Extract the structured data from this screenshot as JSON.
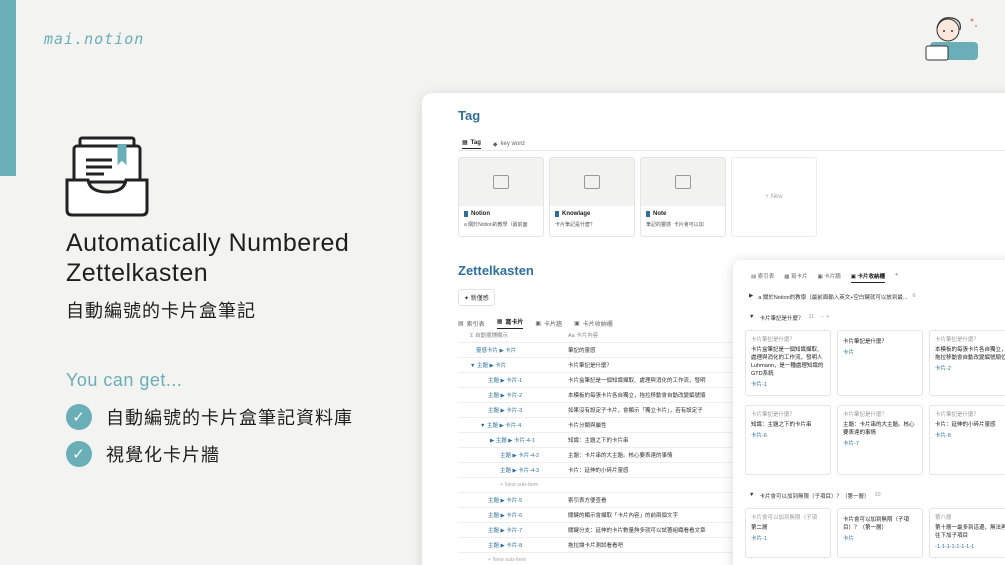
{
  "brand": "mai.notion",
  "hero": {
    "title_line1": "Automatically Numbered",
    "title_line2": "Zettelkasten",
    "title_zh": "自動編號的卡片盒筆記",
    "you_can_get": "You can get...",
    "features": [
      "自動編號的卡片盒筆記資料庫",
      "視覺化卡片牆"
    ]
  },
  "colors": {
    "accent": "#6aaeb8",
    "link": "#2f6f9e"
  },
  "tag_section": {
    "title": "Tag",
    "tabs": [
      "Tag",
      "key word"
    ],
    "cards": [
      {
        "name": "Notion",
        "sub": "a 關於Notion的教學（最前面"
      },
      {
        "name": "Knowlage",
        "sub": "卡片筆記是什麼？"
      },
      {
        "name": "Note",
        "sub": "筆記的靈感"
      }
    ],
    "second_sub": "卡片會可以加",
    "new_label": "+ New"
  },
  "zettel": {
    "title": "Zettelkasten",
    "new_button": "新僅感",
    "tabs": [
      "索引表",
      "寫卡片",
      "卡片牆",
      "卡片收納櫃"
    ],
    "columns": [
      "自動擺鋪顯示",
      "Aa 卡片內容"
    ],
    "rows": [
      {
        "a": "靈感卡片 ▶ 卡片",
        "b": "筆記的靈感"
      },
      {
        "a": "▼ 主題 ▶ 卡片",
        "b": "卡片筆記是什麼？"
      },
      {
        "a": "主題 ▶ 卡片-1",
        "b": "卡片盒筆記是一個知識擷取、處理與消化的工作流，發明"
      },
      {
        "a": "主題 ▶ 卡片-2",
        "b": "本模板的每張卡片各自獨立，拖拉移動會自動改變編號順"
      },
      {
        "a": "主題 ▶ 卡片-3",
        "b": "如果沒有設定子卡片，會顯示「獨立卡片」，若有設定子"
      },
      {
        "a": "▼ 主題 ▶ 卡片-4",
        "b": "卡片分類與屬性"
      },
      {
        "a": "▶ 主題 ▶ 卡片-4-1",
        "b": "知識：主題之下的卡片串"
      },
      {
        "a": "主題 ▶ 卡片-4-2",
        "b": "主題：卡片串的大主題。核心要表達的事情"
      },
      {
        "a": "主題 ▶ 卡片-4-3",
        "b": "卡片：延伸的小碎片靈感"
      },
      {
        "a": "+ New sub-item",
        "b": ""
      },
      {
        "a": "主題 ▶ 卡片-5",
        "b": "索引表方便查看"
      },
      {
        "a": "主題 ▶ 卡片-6",
        "b": "關鍵的顯示會擷取「卡片內容」的前兩個文字"
      },
      {
        "a": "主題 ▶ 卡片-7",
        "b": "關鍵分支：延伸的卡片數量夠多就可以試著組織看看文章"
      },
      {
        "a": "主題 ▶ 卡片-8",
        "b": "拖拉讓卡片測試看看吧"
      },
      {
        "a": "+ New sub-item",
        "b": ""
      }
    ]
  },
  "gallery": {
    "tabs": [
      "索引表",
      "寫卡片",
      "卡片牆",
      "卡片收納櫃"
    ],
    "groups": [
      {
        "title": "a 關於Notion的教學（最前面輸入英文+空白鍵就可以放到最...",
        "count": "6"
      },
      {
        "title": "卡片筆記是什麼？",
        "count": "11"
      },
      {
        "title": "卡片會可以加到無限（子項目）？（第一層）",
        "count": "10"
      }
    ],
    "cards": [
      {
        "lbl": "卡片筆記是什麼？",
        "ttl": "卡片盒筆記是一個知識擷取、處理與消化的工作流，發明人 Luhmann，是一種處理知識的GTD系統",
        "tag": "卡片-1"
      },
      {
        "lbl": "",
        "ttl": "卡片筆記是什麼？",
        "tag": "卡片"
      },
      {
        "lbl": "卡片筆記是什麼？",
        "ttl": "本模板的每張卡片各自獨立，拖拉移動會自動改變編號順位",
        "tag": "卡片-2"
      },
      {
        "lbl": "卡片筆記是什麼？",
        "ttl": "知識：主題之下的卡片串",
        "tag": "卡片-6"
      },
      {
        "lbl": "卡片筆記是什麼？",
        "ttl": "主題：卡片串的大主題。核心要表達的事情",
        "tag": "卡片-7"
      },
      {
        "lbl": "卡片筆記是什麼？",
        "ttl": "卡片：延伸的小碎片靈感",
        "tag": "卡片-8"
      },
      {
        "lbl": "卡片會可以加到無限（子項",
        "ttl": "第二層",
        "tag": "卡片-1"
      },
      {
        "lbl": "",
        "ttl": "卡片會可以加到無限（子項目）？（第一層）",
        "tag": "卡片"
      },
      {
        "lbl": "第八層",
        "ttl": "第十層一最多到這邊，無法再往下加子項目",
        "tag": "-1-1-1-1-1-1-1-1"
      }
    ]
  }
}
